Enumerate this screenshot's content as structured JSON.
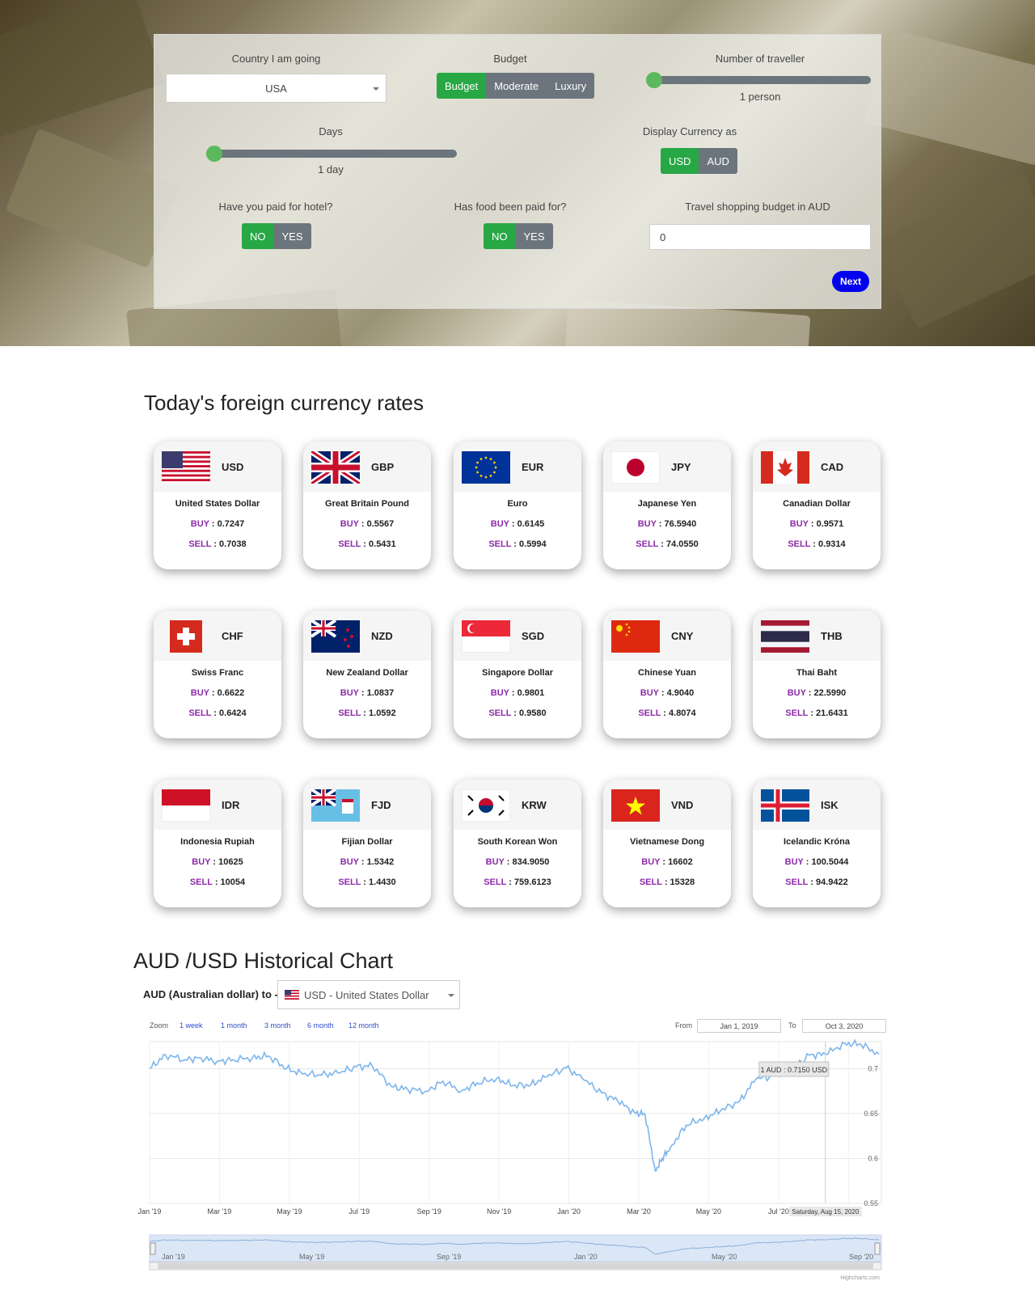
{
  "form": {
    "country_label": "Country I am going",
    "country_value": "USA",
    "budget_label": "Budget",
    "budget_options": [
      "Budget",
      "Moderate",
      "Luxury"
    ],
    "traveller_label": "Number of traveller",
    "traveller_value": "1 person",
    "traveller_level": 0.0,
    "days_label": "Days",
    "days_value": "1 day",
    "days_level": 0.0,
    "currency_label": "Display Currency as",
    "currency_options": [
      "USD",
      "AUD"
    ],
    "hotel_label": "Have you paid for hotel?",
    "hotel_options": [
      "NO",
      "YES"
    ],
    "food_label": "Has food been paid for?",
    "food_options": [
      "NO",
      "YES"
    ],
    "shopping_label": "Travel shopping budget in AUD",
    "shopping_value": "0",
    "next_label": "Next",
    "accent_color": "#28a745",
    "next_color": "#0000ee"
  },
  "rates": {
    "title": "Today's foreign currency rates",
    "buy_key": "BUY",
    "sell_key": "SELL",
    "cards": [
      {
        "code": "USD",
        "name": "United States Dollar",
        "buy": "0.7247",
        "sell": "0.7038",
        "flag": "us-flag-icon"
      },
      {
        "code": "GBP",
        "name": "Great Britain Pound",
        "buy": "0.5567",
        "sell": "0.5431",
        "flag": "gb-flag-icon"
      },
      {
        "code": "EUR",
        "name": "Euro",
        "buy": "0.6145",
        "sell": "0.5994",
        "flag": "eu-flag-icon"
      },
      {
        "code": "JPY",
        "name": "Japanese Yen",
        "buy": "76.5940",
        "sell": "74.0550",
        "flag": "jp-flag-icon"
      },
      {
        "code": "CAD",
        "name": "Canadian Dollar",
        "buy": "0.9571",
        "sell": "0.9314",
        "flag": "ca-flag-icon"
      },
      {
        "code": "CHF",
        "name": "Swiss Franc",
        "buy": "0.6622",
        "sell": "0.6424",
        "flag": "ch-flag-icon"
      },
      {
        "code": "NZD",
        "name": "New Zealand Dollar",
        "buy": "1.0837",
        "sell": "1.0592",
        "flag": "nz-flag-icon"
      },
      {
        "code": "SGD",
        "name": "Singapore Dollar",
        "buy": "0.9801",
        "sell": "0.9580",
        "flag": "sg-flag-icon"
      },
      {
        "code": "CNY",
        "name": "Chinese Yuan",
        "buy": "4.9040",
        "sell": "4.8074",
        "flag": "cn-flag-icon"
      },
      {
        "code": "THB",
        "name": "Thai Baht",
        "buy": "22.5990",
        "sell": "21.6431",
        "flag": "th-flag-icon"
      },
      {
        "code": "IDR",
        "name": "Indonesia Rupiah",
        "buy": "10625",
        "sell": "10054",
        "flag": "id-flag-icon"
      },
      {
        "code": "FJD",
        "name": "Fijian Dollar",
        "buy": "1.5342",
        "sell": "1.4430",
        "flag": "fj-flag-icon"
      },
      {
        "code": "KRW",
        "name": "South Korean Won",
        "buy": "834.9050",
        "sell": "759.6123",
        "flag": "kr-flag-icon"
      },
      {
        "code": "VND",
        "name": "Vietnamese Dong",
        "buy": "16602",
        "sell": "15328",
        "flag": "vn-flag-icon"
      },
      {
        "code": "ISK",
        "name": "Icelandic Króna",
        "buy": "100.5044",
        "sell": "94.9422",
        "flag": "is-flag-icon"
      }
    ]
  },
  "history": {
    "title": "AUD /USD  Historical Chart",
    "pair_label": "AUD (Australian dollar) to -",
    "pair_select": "USD - United States Dollar",
    "zoom_label": "Zoom",
    "zoom_options": [
      "1 week",
      "1 month",
      "3 month",
      "6 month",
      "12 month"
    ],
    "from_label": "From",
    "from_value": "Jan 1, 2019",
    "to_label": "To",
    "to_value": "Oct 3, 2020",
    "tooltip": "1 AUD : 0.7150 USD",
    "hover_date": "Saturday, Aug 15, 2020",
    "credit": "Highcharts.com",
    "navigator_labels": [
      "Jan '19",
      "May '19",
      "Sep '19",
      "Jan '20",
      "May '20",
      "Sep '20"
    ]
  },
  "chart_data": {
    "type": "line",
    "ylim": [
      0.55,
      0.73
    ],
    "x_ticks": [
      "Jan '19",
      "Mar '19",
      "May '19",
      "Jul '19",
      "Sep '19",
      "Nov '19",
      "Jan '20",
      "Mar '20",
      "May '20",
      "Jul '20",
      "Sep '20"
    ],
    "y_ticks": [
      0.55,
      0.6,
      0.65,
      0.7
    ],
    "series_color": "#7cb5ec",
    "series": [
      {
        "x": [
          "2019-01-01",
          "2019-01-15",
          "2019-02-01",
          "2019-02-15",
          "2019-03-01",
          "2019-03-15",
          "2019-04-01",
          "2019-04-15",
          "2019-05-01",
          "2019-05-15",
          "2019-06-01",
          "2019-06-15",
          "2019-07-01",
          "2019-07-15",
          "2019-08-01",
          "2019-08-15",
          "2019-09-01",
          "2019-09-15",
          "2019-10-01",
          "2019-10-15",
          "2019-11-01",
          "2019-11-15",
          "2019-12-01",
          "2019-12-15",
          "2020-01-01",
          "2020-01-15",
          "2020-02-01",
          "2020-02-15",
          "2020-03-01",
          "2020-03-10",
          "2020-03-19",
          "2020-03-25",
          "2020-04-01",
          "2020-04-15",
          "2020-05-01",
          "2020-05-15",
          "2020-06-01",
          "2020-06-15",
          "2020-07-01",
          "2020-07-15",
          "2020-08-01",
          "2020-08-15",
          "2020-09-01",
          "2020-09-15",
          "2020-10-01"
        ],
        "y": [
          0.7,
          0.715,
          0.71,
          0.712,
          0.708,
          0.71,
          0.712,
          0.714,
          0.7,
          0.694,
          0.693,
          0.695,
          0.702,
          0.703,
          0.68,
          0.677,
          0.675,
          0.686,
          0.675,
          0.684,
          0.689,
          0.681,
          0.682,
          0.691,
          0.701,
          0.689,
          0.673,
          0.664,
          0.651,
          0.649,
          0.586,
          0.6,
          0.612,
          0.637,
          0.645,
          0.653,
          0.664,
          0.688,
          0.692,
          0.699,
          0.715,
          0.716,
          0.728,
          0.727,
          0.716
        ]
      }
    ]
  }
}
